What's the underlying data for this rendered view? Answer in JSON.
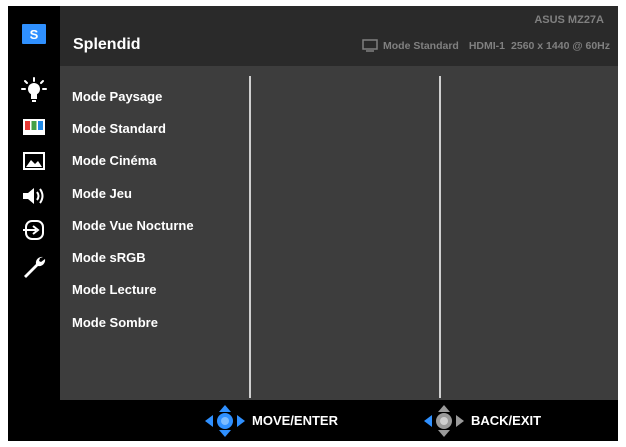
{
  "header": {
    "model": "ASUS MZ27A",
    "title": "Splendid",
    "status": {
      "current_mode": "Mode Standard",
      "input": "HDMI-1",
      "resolution": "2560 x 1440 @ 60Hz"
    }
  },
  "sidebar": {
    "items": [
      {
        "name": "splendid",
        "label": "S",
        "icon": "splendid-icon",
        "active": true,
        "accent": "#2f90ff"
      },
      {
        "name": "blue-light-filter",
        "icon": "lightbulb-icon",
        "active": false
      },
      {
        "name": "color",
        "icon": "color-bars-icon",
        "active": false
      },
      {
        "name": "image",
        "icon": "image-icon",
        "active": false
      },
      {
        "name": "sound",
        "icon": "speaker-icon",
        "active": false
      },
      {
        "name": "input-select",
        "icon": "input-icon",
        "active": false
      },
      {
        "name": "system-setup",
        "icon": "wrench-icon",
        "active": false
      }
    ]
  },
  "modes": [
    "Mode Paysage",
    "Mode Standard",
    "Mode Cinéma",
    "Mode Jeu",
    "Mode Vue Nocturne",
    "Mode sRGB",
    "Mode Lecture",
    "Mode Sombre"
  ],
  "footer": {
    "move_enter": "MOVE/ENTER",
    "back_exit": "BACK/EXIT"
  },
  "colors": {
    "accent": "#2f90ff",
    "header_bg": "#2a2a2a",
    "content_bg": "#3d3d3d"
  }
}
